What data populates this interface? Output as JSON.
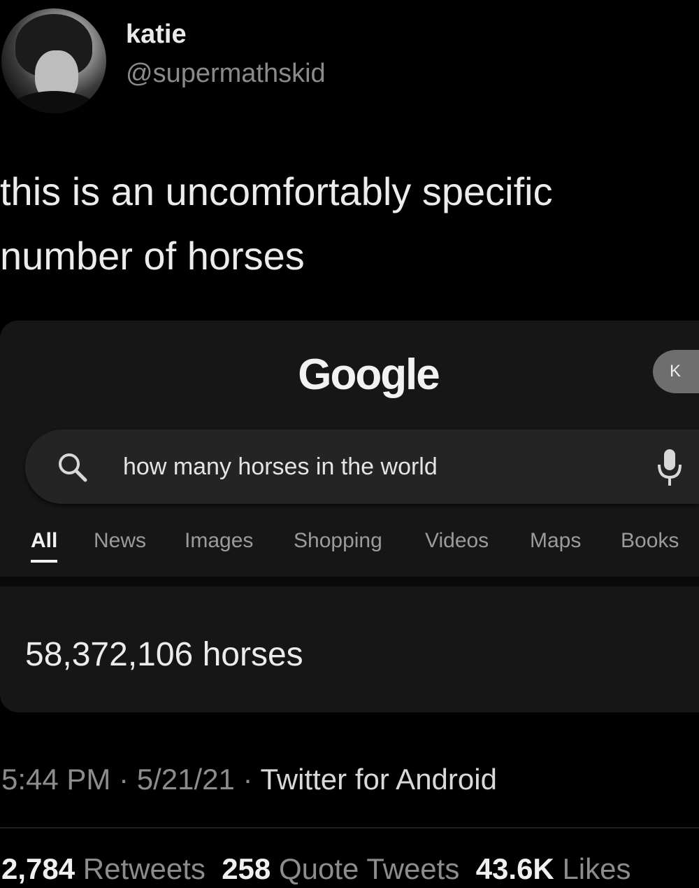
{
  "author": {
    "display_name": "katie",
    "handle": "@supermathskid"
  },
  "tweet": {
    "text": "this is an uncomfortably specific number of horses"
  },
  "google_card": {
    "logo": "Google",
    "account_initial": "K",
    "search": {
      "query": "how many horses in the world"
    },
    "tabs": [
      {
        "label": "All"
      },
      {
        "label": "News"
      },
      {
        "label": "Images"
      },
      {
        "label": "Shopping"
      },
      {
        "label": "Videos"
      },
      {
        "label": "Maps"
      },
      {
        "label": "Books"
      }
    ],
    "answer": "58,372,106 horses"
  },
  "meta": {
    "time": "5:44 PM",
    "date": "5/21/21",
    "source": "Twitter for Android",
    "separator": " · "
  },
  "stats": {
    "retweets_count": "2,784",
    "retweets_label": "Retweets",
    "quotes_count": "258",
    "quotes_label": "Quote Tweets",
    "likes_count": "43.6K",
    "likes_label": "Likes"
  },
  "colors": {
    "background": "#000000",
    "card": "#161616",
    "search_bar": "#242424",
    "muted_text": "#8c8c8c"
  }
}
